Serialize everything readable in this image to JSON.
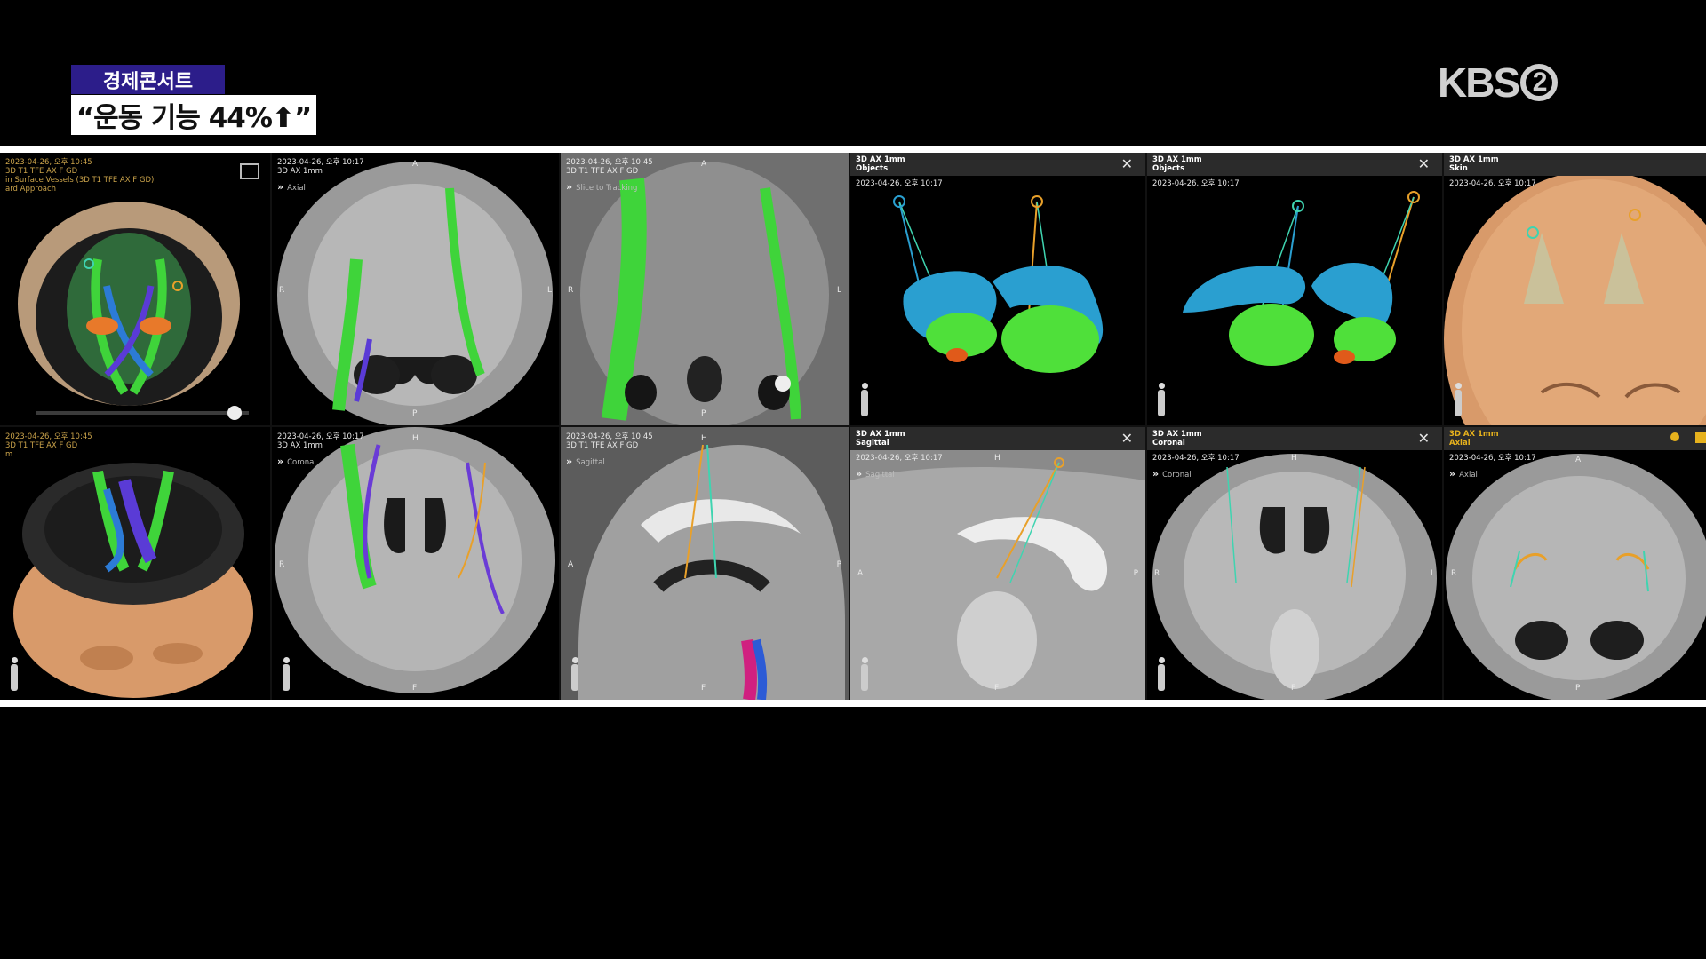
{
  "broadcast": {
    "program_tag": "경제콘서트",
    "headline": "“운동 기능 44%⬆”",
    "channel_logo": "KBS",
    "channel_number": "2"
  },
  "panels": [
    {
      "id": "p1",
      "lines": [
        "2023-04-26, 오후 10:45",
        "3D T1 TFE AX F GD",
        "in Surface Vessels (3D T1 TFE AX F GD)",
        "ard Approach"
      ],
      "has_close": false
    },
    {
      "id": "p2",
      "lines": [
        "2023-04-26, 오후 10:17",
        "3D AX 1mm"
      ],
      "view": "Axial",
      "has_close": false
    },
    {
      "id": "p3",
      "lines": [
        "2023-04-26, 오후 10:45",
        "3D T1 TFE AX F GD"
      ],
      "view": "Slice to Tracking",
      "has_close": false
    },
    {
      "id": "p4",
      "title": [
        "3D AX 1mm",
        "Objects"
      ],
      "lines": [
        "2023-04-26, 오후 10:17"
      ],
      "has_close": true
    },
    {
      "id": "p5",
      "title": [
        "3D AX 1mm",
        "Objects"
      ],
      "lines": [
        "2023-04-26, 오후 10:17"
      ],
      "has_close": true
    },
    {
      "id": "p6",
      "title": [
        "3D AX 1mm",
        "Skin"
      ],
      "lines": [
        "2023-04-26, 오후 10:17"
      ],
      "has_close": false
    },
    {
      "id": "p7",
      "lines": [
        "2023-04-26, 오후 10:45",
        "3D T1 TFE AX F GD",
        "m"
      ],
      "has_close": false
    },
    {
      "id": "p8",
      "lines": [
        "2023-04-26, 오후 10:17",
        "3D AX 1mm"
      ],
      "view": "Coronal",
      "has_close": false
    },
    {
      "id": "p9",
      "lines": [
        "2023-04-26, 오후 10:45",
        "3D T1 TFE AX F GD"
      ],
      "view": "Sagittal",
      "has_close": false
    },
    {
      "id": "p10",
      "title": [
        "3D AX 1mm",
        "Sagittal"
      ],
      "lines": [
        "2023-04-26, 오후 10:17"
      ],
      "view": "Sagittal",
      "has_close": true
    },
    {
      "id": "p11",
      "title": [
        "3D AX 1mm",
        "Coronal"
      ],
      "lines": [
        "2023-04-26, 오후 10:17"
      ],
      "view": "Coronal",
      "has_close": true
    },
    {
      "id": "p12",
      "title": [
        "3D AX 1mm",
        "Axial"
      ],
      "lines": [
        "2023-04-26, 오후 10:17"
      ],
      "view": "Axial",
      "has_close": false
    }
  ],
  "orientation_labels": {
    "anterior": "A",
    "posterior": "P",
    "right": "R",
    "left": "L",
    "head": "H",
    "foot": "F"
  },
  "colors": {
    "tag_bg": "#2c1d8a",
    "tract_green": "#3fd43a",
    "tract_blue": "#2c7bd6",
    "target_cyan": "#2a9fd0",
    "target_green": "#4fe03a",
    "skin": "#d89a6a"
  }
}
